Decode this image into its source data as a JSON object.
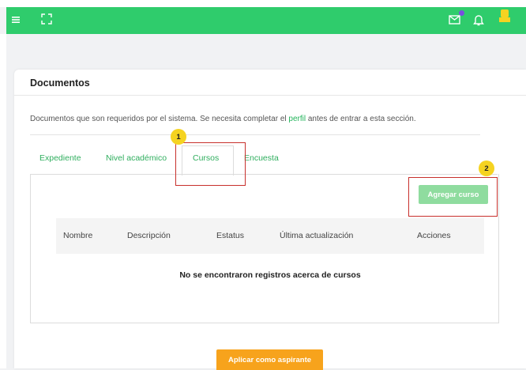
{
  "topbar": {
    "color": "#2fcc6c",
    "left_icons": [
      "menu-icon",
      "fullscreen-icon"
    ],
    "right_icons": [
      "mail-icon",
      "bell-icon",
      "user-avatar"
    ]
  },
  "card": {
    "title": "Documentos",
    "description_before": "Documentos que son requeridos por el sistema. Se necesita completar el ",
    "description_link": "perfil",
    "description_after": " antes de entrar a esta sección."
  },
  "tabs": [
    {
      "label": "Expediente",
      "active": false
    },
    {
      "label": "Nivel académico",
      "active": false
    },
    {
      "label": "Cursos",
      "active": true
    },
    {
      "label": "Encuesta",
      "active": false
    }
  ],
  "add_button": "Agregar curso",
  "table": {
    "columns": [
      "Nombre",
      "Descripción",
      "Estatus",
      "Última actualización",
      "Acciones"
    ],
    "empty_message": "No se encontraron registros acerca de cursos"
  },
  "apply_button": "Aplicar como aspirante",
  "annotations": [
    {
      "number": "1",
      "target": "tab-cursos"
    },
    {
      "number": "2",
      "target": "add-course-button"
    }
  ],
  "colors": {
    "accent": "#2fcc6c",
    "tab_text": "#2fae5e",
    "add_button": "#8fdc9f",
    "apply_button": "#f7a31c",
    "highlight": "#c8302c",
    "badge": "#f5d321"
  }
}
